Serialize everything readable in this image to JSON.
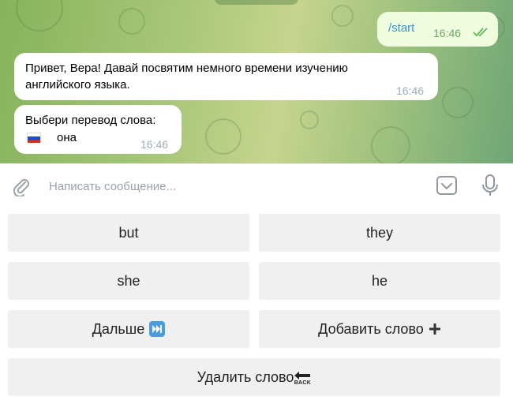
{
  "chat": {
    "messages": [
      {
        "direction": "outgoing",
        "text": "/start",
        "time": "16:46",
        "status": "read"
      },
      {
        "direction": "incoming",
        "text_line1": "Привет, Вера! Давай посвятим немного времени изучению",
        "text_line2": "английского языка.",
        "time": "16:46"
      },
      {
        "direction": "incoming",
        "text_line1": "Выбери перевод слова:",
        "flag": "russia-flag-icon",
        "word": "она",
        "time": "16:46"
      }
    ]
  },
  "composer": {
    "placeholder": "Написать сообщение...",
    "attach_icon": "paperclip-icon",
    "keyboard_icon": "bot-keyboard-icon",
    "mic_icon": "microphone-icon"
  },
  "keyboard": {
    "buttons": [
      {
        "label": "but"
      },
      {
        "label": "they"
      },
      {
        "label": "she"
      },
      {
        "label": "he"
      },
      {
        "label": "Дальше",
        "emoji": "next-track-icon"
      },
      {
        "label": "Добавить слово",
        "emoji": "plus-icon"
      },
      {
        "label": "Удалить слово",
        "emoji": "back-arrow-icon",
        "emoji_text": "BACK"
      }
    ]
  },
  "colors": {
    "accent": "#5aa0d8",
    "read_ticks": "#5cb85c",
    "button_bg": "#f0f0f0",
    "outgoing_bubble": "#effdde"
  }
}
